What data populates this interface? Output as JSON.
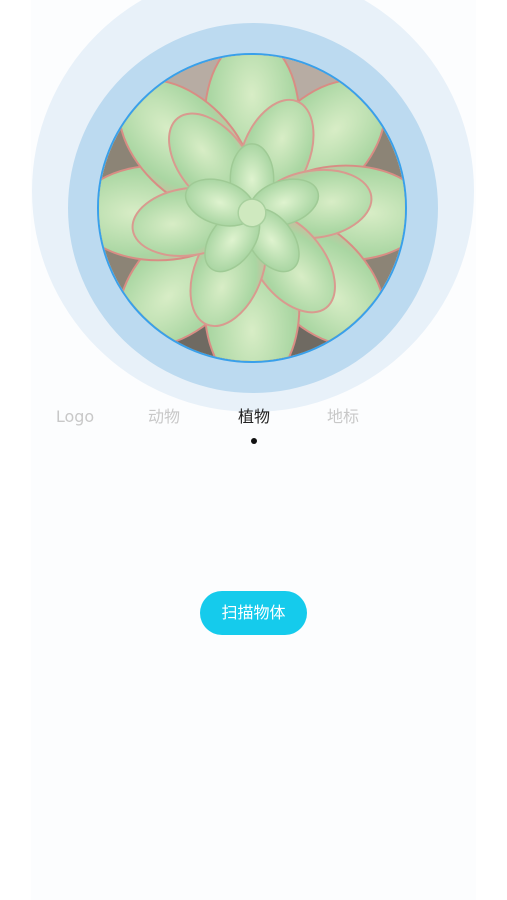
{
  "tabs": [
    {
      "label": "Logo",
      "active": false
    },
    {
      "label": "动物",
      "active": false
    },
    {
      "label": "植物",
      "active": true
    },
    {
      "label": "地标",
      "active": false
    }
  ],
  "scan_button": {
    "label": "扫描物体"
  },
  "colors": {
    "outer_ring": "#e8f1f9",
    "middle_ring": "#bcdaf0",
    "photo_border": "#39a0ea",
    "button_bg": "#15cbec",
    "tab_active": "#222222",
    "tab_inactive": "#c8c8c8"
  },
  "icons": {
    "preview_image": "succulent-plant-photo"
  }
}
